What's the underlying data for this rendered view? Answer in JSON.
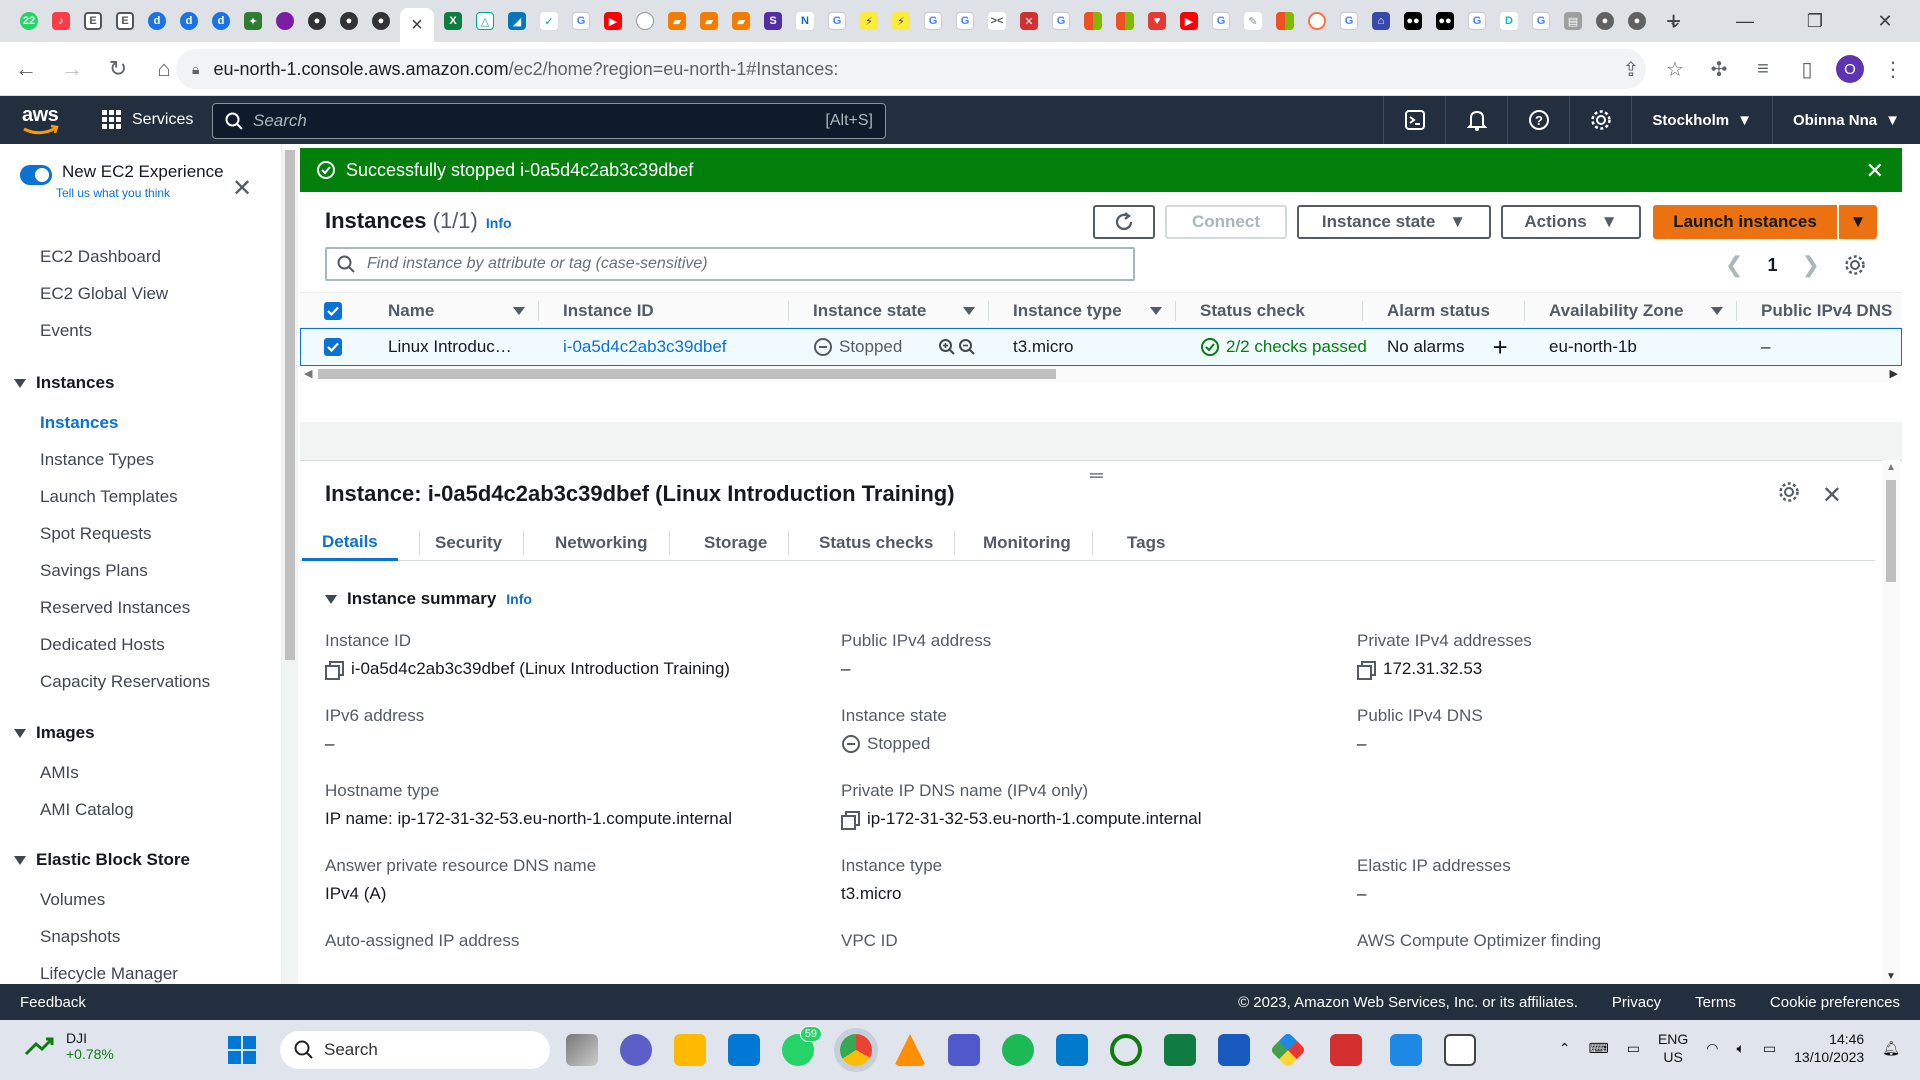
{
  "browser": {
    "tab_count_badge": "22",
    "active_tab_close": "×",
    "new_tab": "+",
    "url_host": "eu-north-1.console.aws.amazon.com",
    "url_path": "/ec2/home?region=eu-north-1#Instances:",
    "profile_initial": "O"
  },
  "aws_nav": {
    "logo": "aws",
    "services": "Services",
    "search_placeholder": "Search",
    "search_shortcut": "[Alt+S]",
    "region": "Stockholm",
    "user": "Obinna Nna"
  },
  "sidebar": {
    "experience_label": "New EC2 Experience",
    "experience_sub": "Tell us what you think",
    "top_items": [
      "EC2 Dashboard",
      "EC2 Global View",
      "Events"
    ],
    "instances_head": "Instances",
    "instances_items": [
      "Instances",
      "Instance Types",
      "Launch Templates",
      "Spot Requests",
      "Savings Plans",
      "Reserved Instances",
      "Dedicated Hosts",
      "Capacity Reservations"
    ],
    "images_head": "Images",
    "images_items": [
      "AMIs",
      "AMI Catalog"
    ],
    "ebs_head": "Elastic Block Store",
    "ebs_items": [
      "Volumes",
      "Snapshots",
      "Lifecycle Manager"
    ]
  },
  "flash": {
    "message": "Successfully stopped i-0a5d4c2ab3c39dbef"
  },
  "instances_panel": {
    "title": "Instances",
    "count": "(1/1)",
    "info": "Info",
    "connect": "Connect",
    "instance_state": "Instance state",
    "actions": "Actions",
    "launch": "Launch instances",
    "filter_placeholder": "Find instance by attribute or tag (case-sensitive)",
    "page": "1",
    "columns": [
      "Name",
      "Instance ID",
      "Instance state",
      "Instance type",
      "Status check",
      "Alarm status",
      "Availability Zone",
      "Public IPv4 DNS"
    ],
    "row": {
      "name": "Linux Introduc…",
      "id": "i-0a5d4c2ab3c39dbef",
      "state": "Stopped",
      "type": "t3.micro",
      "status": "2/2 checks passed",
      "alarm": "No alarms",
      "az": "eu-north-1b",
      "dns": "–"
    }
  },
  "details": {
    "title": "Instance: i-0a5d4c2ab3c39dbef (Linux Introduction Training)",
    "tabs": [
      "Details",
      "Security",
      "Networking",
      "Storage",
      "Status checks",
      "Monitoring",
      "Tags"
    ],
    "summary": "Instance summary",
    "info": "Info",
    "fields": {
      "instance_id_k": "Instance ID",
      "instance_id_v": "i-0a5d4c2ab3c39dbef (Linux Introduction Training)",
      "pub_ipv4_k": "Public IPv4 address",
      "pub_ipv4_v": "–",
      "priv_ipv4_k": "Private IPv4 addresses",
      "priv_ipv4_v": "172.31.32.53",
      "ipv6_k": "IPv6 address",
      "ipv6_v": "–",
      "state_k": "Instance state",
      "state_v": "Stopped",
      "pub_dns_k": "Public IPv4 DNS",
      "pub_dns_v": "–",
      "hostname_k": "Hostname type",
      "hostname_v": "IP name: ip-172-31-32-53.eu-north-1.compute.internal",
      "priv_dns_k": "Private IP DNS name (IPv4 only)",
      "priv_dns_v": "ip-172-31-32-53.eu-north-1.compute.internal",
      "answer_k": "Answer private resource DNS name",
      "answer_v": "IPv4 (A)",
      "type_k": "Instance type",
      "type_v": "t3.micro",
      "eip_k": "Elastic IP addresses",
      "eip_v": "–",
      "auto_ip_k": "Auto-assigned IP address",
      "vpc_k": "VPC ID",
      "optimizer_k": "AWS Compute Optimizer finding"
    }
  },
  "footer": {
    "feedback": "Feedback",
    "copyright": "© 2023, Amazon Web Services, Inc. or its affiliates.",
    "privacy": "Privacy",
    "terms": "Terms",
    "cookies": "Cookie preferences"
  },
  "taskbar": {
    "stock": "DJI",
    "stock_change": "+0.78%",
    "search": "Search",
    "badge": "59",
    "lang1": "ENG",
    "lang2": "US",
    "time": "14:46",
    "date": "13/10/2023"
  },
  "colors": {
    "aws_nav": "#232f3e",
    "flash_success": "#037f0c",
    "primary_button": "#ec7211",
    "link": "#0972d3"
  }
}
